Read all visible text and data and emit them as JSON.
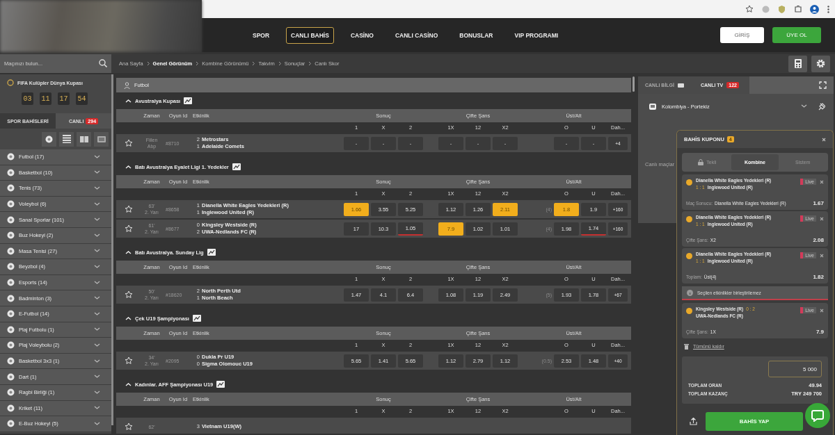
{
  "header": {
    "nav": [
      {
        "label": "SPOR",
        "selected": false
      },
      {
        "label": "CANLI BAHİS",
        "selected": true
      },
      {
        "label": "CASİNO",
        "selected": false
      },
      {
        "label": "CANLI CASİNO",
        "selected": false
      },
      {
        "label": "BONUSLAR",
        "selected": false
      },
      {
        "label": "VIP PROGRAMI",
        "selected": false
      }
    ],
    "buttons": [
      {
        "label": "GİRİŞ",
        "kind": "login"
      },
      {
        "label": "ÜYE OL",
        "kind": "signup"
      }
    ]
  },
  "search": {
    "placeholder": "Maçınızı bulun..."
  },
  "breadcrumb": [
    {
      "label": "Ana Sayfa",
      "selected": false
    },
    {
      "label": "Genel Görünüm",
      "selected": true
    },
    {
      "label": "Kombine Görünümü",
      "selected": false
    },
    {
      "label": "Takvim",
      "selected": false
    },
    {
      "label": "Sonuçlar",
      "selected": false
    },
    {
      "label": "Canlı Skor",
      "selected": false
    }
  ],
  "sidebar": {
    "promo": {
      "title": "FIFA Kulüpler Dünya Kupası",
      "countdown": [
        "03",
        "11",
        "17",
        "54"
      ]
    },
    "tabs": [
      {
        "label": "SPOR BAHİSLERİ",
        "selected": false
      },
      {
        "label": "CANLI",
        "badge": "294",
        "selected": true
      }
    ],
    "sports": [
      {
        "label": "Futbol (17)"
      },
      {
        "label": "Basketbol (10)"
      },
      {
        "label": "Tenis (73)"
      },
      {
        "label": "Voleybol (6)"
      },
      {
        "label": "Sanal Sporlar (101)"
      },
      {
        "label": "Buz Hokeyi (2)"
      },
      {
        "label": "Masa Tenisi (27)"
      },
      {
        "label": "Beyzbol (4)"
      },
      {
        "label": "Esports (14)"
      },
      {
        "label": "Badminton (3)"
      },
      {
        "label": "E-Futbol (14)"
      },
      {
        "label": "Plaj Futbolu (1)"
      },
      {
        "label": "Plaj Voleybolu (2)"
      },
      {
        "label": "Basketbol 3x3 (1)"
      },
      {
        "label": "Dart (1)"
      },
      {
        "label": "Ragbi Birliği (1)"
      },
      {
        "label": "Kriket (11)"
      },
      {
        "label": "E-Buz Hokeyi (5)"
      }
    ]
  },
  "main": {
    "sport": "Futbol",
    "leagues": [
      {
        "name": "Avustralya Kupası",
        "expanded": true,
        "columns": [
          "Zaman",
          "Oyun Id",
          "Etkinlik",
          "Sonuç",
          "Çifte Şans",
          "Üst/Alt"
        ],
        "outcomes": [
          "1",
          "X",
          "2",
          "1X",
          "12",
          "X2",
          "O",
          "U",
          "Dah..."
        ],
        "matches": [
          {
            "time": "Fiilen",
            "period": "Atıp",
            "id": "#8710",
            "teams": [
              {
                "score": "2",
                "name": "Metrostars"
              },
              {
                "score": "1",
                "name": "Adelaide Comets"
              }
            ],
            "odds": [
              {
                "value": "-",
                "selected": false,
                "dropped": false
              },
              {
                "value": "-",
                "selected": false,
                "dropped": false
              },
              {
                "value": "-",
                "selected": false,
                "dropped": false
              },
              {
                "value": "-",
                "selected": false,
                "dropped": false
              },
              {
                "value": "-",
                "selected": false,
                "dropped": false
              },
              {
                "value": "-",
                "selected": false,
                "dropped": false
              },
              {
                "value": "-",
                "selected": false,
                "dropped": false
              },
              {
                "value": "-",
                "selected": false,
                "dropped": false
              }
            ],
            "more": "+4"
          }
        ]
      },
      {
        "name": "Batı Avustralya Eyalet Ligi 1. Yedekler",
        "expanded": true,
        "columns": [
          "Zaman",
          "Oyun Id",
          "Etkinlik",
          "Sonuç",
          "Çifte Şans",
          "Üst/Alt"
        ],
        "outcomes": [
          "1",
          "X",
          "2",
          "1X",
          "12",
          "X2",
          "O",
          "U",
          "Dah..."
        ],
        "matches": [
          {
            "time": "63'",
            "period": "2. Yarı",
            "id": "#8658",
            "teams": [
              {
                "score": "1",
                "name": "Dianella White Eagles Yedekleri (R)"
              },
              {
                "score": "1",
                "name": "Inglewood United (R)"
              }
            ],
            "odds": [
              {
                "value": "1.66",
                "selected": true,
                "dropped": false
              },
              {
                "value": "3.55",
                "selected": false,
                "dropped": false
              },
              {
                "value": "5.25",
                "selected": false,
                "dropped": false
              },
              {
                "value": "1.12",
                "selected": false,
                "dropped": false
              },
              {
                "value": "1.26",
                "selected": false,
                "dropped": false
              },
              {
                "value": "2.11",
                "selected": true,
                "dropped": false
              },
              {
                "value": "1.8",
                "selected": true,
                "dropped": false
              },
              {
                "value": "1.9",
                "selected": false,
                "dropped": false
              }
            ],
            "line": "(4)",
            "more": "+160"
          },
          {
            "time": "61'",
            "period": "2. Yarı",
            "id": "#8677",
            "teams": [
              {
                "score": "0",
                "name": "Kingsley Westside (R)"
              },
              {
                "score": "2",
                "name": "UWA-Nedlands FC (R)"
              }
            ],
            "odds": [
              {
                "value": "17",
                "selected": false,
                "dropped": false
              },
              {
                "value": "10.3",
                "selected": false,
                "dropped": false
              },
              {
                "value": "1.05",
                "selected": false,
                "dropped": true
              },
              {
                "value": "7.9",
                "selected": true,
                "dropped": false
              },
              {
                "value": "1.02",
                "selected": false,
                "dropped": false
              },
              {
                "value": "1.01",
                "selected": false,
                "dropped": false
              },
              {
                "value": "1.98",
                "selected": false,
                "dropped": false
              },
              {
                "value": "1.74",
                "selected": false,
                "dropped": true
              }
            ],
            "line": "(4)",
            "more": "+160"
          }
        ]
      },
      {
        "name": "Batı Avustralya. Sunday Lig",
        "expanded": true,
        "columns": [
          "Zaman",
          "Oyun Id",
          "Etkinlik",
          "Sonuç",
          "Çifte Şans",
          "Üst/Alt"
        ],
        "outcomes": [
          "1",
          "X",
          "2",
          "1X",
          "12",
          "X2",
          "O",
          "U",
          "Dah..."
        ],
        "matches": [
          {
            "time": "50'",
            "period": "2. Yarı",
            "id": "#18620",
            "teams": [
              {
                "score": "2",
                "name": "North Perth Utd"
              },
              {
                "score": "1",
                "name": "North Beach"
              }
            ],
            "odds": [
              {
                "value": "1.47",
                "selected": false,
                "dropped": false
              },
              {
                "value": "4.1",
                "selected": false,
                "dropped": false
              },
              {
                "value": "6.4",
                "selected": false,
                "dropped": false
              },
              {
                "value": "1.08",
                "selected": false,
                "dropped": false
              },
              {
                "value": "1.19",
                "selected": false,
                "dropped": false
              },
              {
                "value": "2.49",
                "selected": false,
                "dropped": false
              },
              {
                "value": "1.93",
                "selected": false,
                "dropped": false
              },
              {
                "value": "1.78",
                "selected": false,
                "dropped": false
              }
            ],
            "line": "(5)",
            "more": "+67"
          }
        ]
      },
      {
        "name": "Çek U19 Şampiyonası",
        "expanded": true,
        "columns": [
          "Zaman",
          "Oyun Id",
          "Etkinlik",
          "Sonuç",
          "Çifte Şans",
          "Üst/Alt"
        ],
        "outcomes": [
          "1",
          "X",
          "2",
          "1X",
          "12",
          "X2",
          "O",
          "U",
          "Dah..."
        ],
        "matches": [
          {
            "time": "34'",
            "period": "2. Yarı",
            "id": "#2095",
            "teams": [
              {
                "score": "0",
                "name": "Dukla Pr U19"
              },
              {
                "score": "0",
                "name": "Sigma Olomouc U19"
              }
            ],
            "odds": [
              {
                "value": "5.65",
                "selected": false,
                "dropped": false
              },
              {
                "value": "1.41",
                "selected": false,
                "dropped": false
              },
              {
                "value": "5.65",
                "selected": false,
                "dropped": false
              },
              {
                "value": "1.12",
                "selected": false,
                "dropped": false
              },
              {
                "value": "2.79",
                "selected": false,
                "dropped": false
              },
              {
                "value": "1.12",
                "selected": false,
                "dropped": false
              },
              {
                "value": "2.53",
                "selected": false,
                "dropped": false
              },
              {
                "value": "1.48",
                "selected": false,
                "dropped": false
              }
            ],
            "line": "(0.5)",
            "more": "+40"
          }
        ]
      },
      {
        "name": "Kadınlar. AFF Şampiyonası U19",
        "expanded": true,
        "columns": [
          "Zaman",
          "Oyun Id",
          "Etkinlik",
          "Sonuç",
          "Çifte Şans",
          "Üst/Alt"
        ],
        "outcomes": [
          "1",
          "X",
          "2",
          "1X",
          "12",
          "X2",
          "O",
          "U",
          "Dah..."
        ],
        "matches": [
          {
            "time": "62'",
            "teams": [
              {
                "score": "3",
                "name": "Vietnam U19(W)"
              }
            ]
          }
        ]
      }
    ]
  },
  "live_panel": {
    "tabs": [
      {
        "label": "CANLI BİLGİ",
        "selected": false
      },
      {
        "label": "CANLI TV",
        "badge": "122",
        "selected": true
      }
    ],
    "match": "Kolombiya - Portekiz",
    "message": "Canlı maçlar"
  },
  "coupon": {
    "title": "BAHİS KUPONU",
    "count": "4",
    "tabs": [
      {
        "label": "Tekli",
        "selected": false
      },
      {
        "label": "Kombine",
        "selected": true
      },
      {
        "label": "Sistem",
        "selected": false
      }
    ],
    "items": [
      {
        "kind": "score-below",
        "home": "Dianella White Eagles Yedekleri (R)",
        "score": "1 : 1",
        "away": "Inglewood United (R)",
        "live": "Live",
        "market": "Maç Sonucu:",
        "pick": "Dianella White Eagles Yedekleri (R)",
        "odd": "1.67"
      },
      {
        "kind": "score-below",
        "home": "Dianella White Eagles Yedekleri (R)",
        "score": "1 : 1",
        "away": "Inglewood United (R)",
        "live": "Live",
        "market": "Çifte Şans:",
        "pick": "X2",
        "odd": "2.08"
      },
      {
        "kind": "score-below",
        "home": "Dianella White Eagles Yedekleri (R)",
        "score": "1 : 1",
        "away": "Inglewood United (R)",
        "live": "Live",
        "market": "Toplam:",
        "pick": "Üst(4)",
        "odd": "1.82"
      },
      {
        "kind": "warning",
        "text": "Seçilen etkinlikler birleştirilemez"
      },
      {
        "kind": "score-beside",
        "home": "Kingsley Westside (R)",
        "score": "0 : 2",
        "away": "UWA-Nedlands FC (R)",
        "live": "Live",
        "market": "Çifte Şans:",
        "pick": "1X",
        "odd": "7.9"
      }
    ],
    "clear": "Tümünü kaldır",
    "stake": "5 000",
    "totals": [
      {
        "label": "TOPLAM ORAN",
        "value": "49.94"
      },
      {
        "label": "TOPLAM KAZANÇ",
        "value": "TRY 249 700"
      }
    ],
    "submit": "BAHİS YAP"
  }
}
